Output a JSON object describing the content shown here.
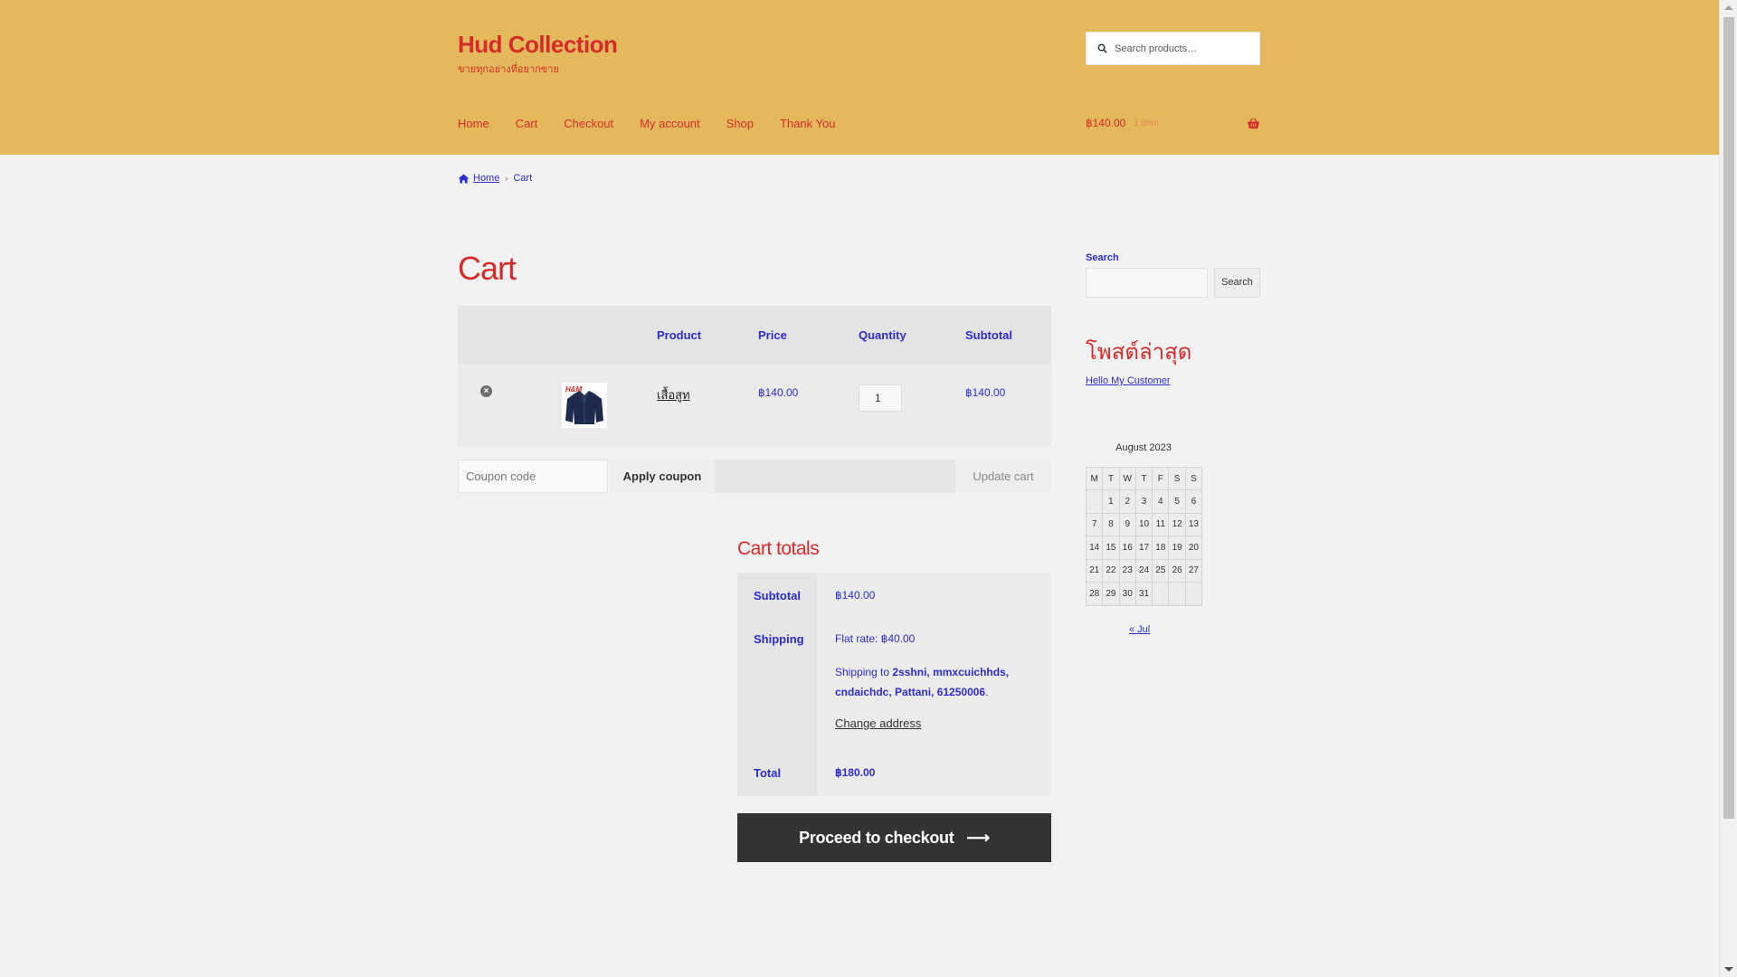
{
  "header": {
    "title": "Hud Collection",
    "tagline": "ขายทุกอย่างที่อยากขาย",
    "search_placeholder": "Search products…",
    "nav": [
      "Home",
      "Cart",
      "Checkout",
      "My account",
      "Shop",
      "Thank You"
    ],
    "cart_amount": "฿140.00",
    "cart_count": "1 item",
    "brand_color": "#e3b95b",
    "accent_color": "#d62b2b"
  },
  "breadcrumb": {
    "home": "Home",
    "current": "Cart"
  },
  "page": {
    "title": "Cart"
  },
  "cart": {
    "headers": {
      "product": "Product",
      "price": "Price",
      "quantity": "Quantity",
      "subtotal": "Subtotal"
    },
    "items": [
      {
        "remove_icon": "remove-circle-icon",
        "thumb_logo": "H&M",
        "name": "เสื้อสูท",
        "price": "฿140.00",
        "quantity": "1",
        "subtotal": "฿140.00"
      }
    ],
    "coupon_placeholder": "Coupon code",
    "apply_coupon": "Apply coupon",
    "update_cart": "Update cart"
  },
  "totals": {
    "title": "Cart totals",
    "subtotal_label": "Subtotal",
    "subtotal_value": "฿140.00",
    "shipping_label": "Shipping",
    "shipping_method_prefix": "Flat rate: ",
    "shipping_method_amount": "฿40.00",
    "shipping_to_prefix": "Shipping to ",
    "shipping_address": "2sshni, mmxcuichhds, cndaichdc, Pattani, 61250006",
    "change_address": "Change address",
    "total_label": "Total",
    "total_value": "฿180.00",
    "checkout_label": "Proceed to checkout",
    "checkout_arrow_icon": "arrow-right-icon"
  },
  "sidebar": {
    "search_label": "Search",
    "search_button": "Search",
    "recent_title": "โพสต์ล่าสุด",
    "recent_posts": [
      "Hello My Customer"
    ],
    "calendar": {
      "caption": "August 2023",
      "days": [
        "M",
        "T",
        "W",
        "T",
        "F",
        "S",
        "S"
      ],
      "weeks": [
        [
          "",
          "1",
          "2",
          "3",
          "4",
          "5",
          "6"
        ],
        [
          "7",
          "8",
          "9",
          "10",
          "11",
          "12",
          "13"
        ],
        [
          "14",
          "15",
          "16",
          "17",
          "18",
          "19",
          "20"
        ],
        [
          "21",
          "22",
          "23",
          "24",
          "25",
          "26",
          "27"
        ],
        [
          "28",
          "29",
          "30",
          "31",
          "",
          "",
          ""
        ]
      ],
      "prev": "« Jul"
    }
  }
}
